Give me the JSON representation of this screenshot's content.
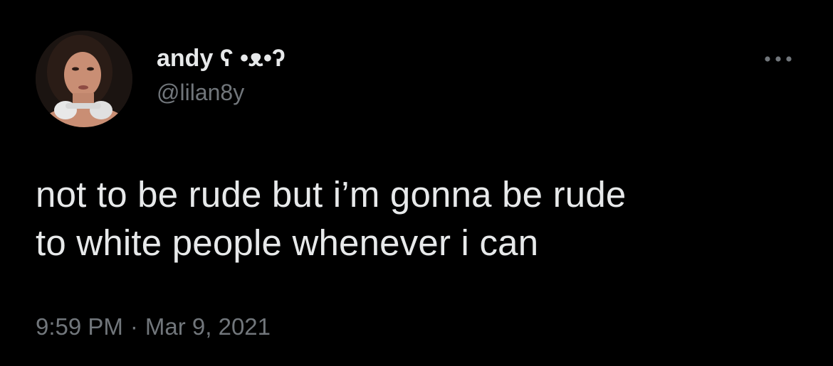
{
  "user": {
    "display_name": "andy ʕ •ᴥ•ʔ",
    "handle": "@lilan8y",
    "avatar_icon": "user-avatar-photo"
  },
  "more_icon": "more-horizontal-icon",
  "tweet": {
    "lines": [
      "not to be rude but i’m gonna be rude",
      "to white people whenever i can"
    ],
    "time": "9:59 PM",
    "separator": "·",
    "date": "Mar 9, 2021"
  },
  "colors": {
    "background": "#000000",
    "primary_text": "#e7e9ea",
    "secondary_text": "#71767b"
  }
}
